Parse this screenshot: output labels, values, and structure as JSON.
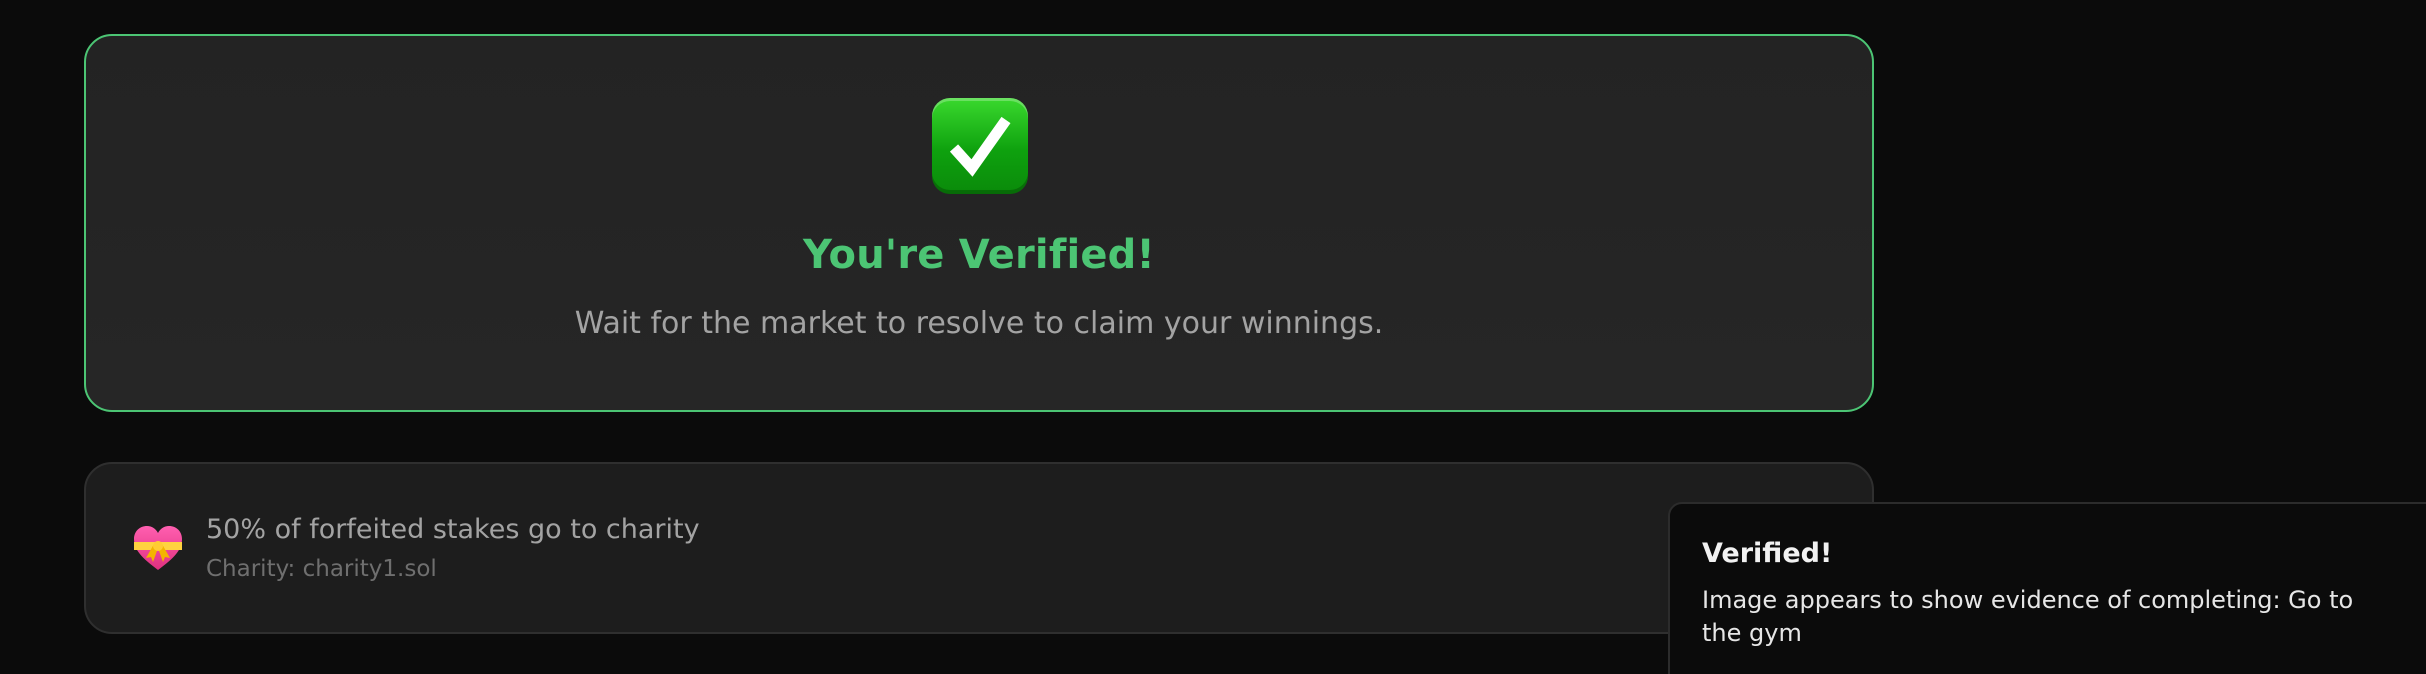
{
  "verified_card": {
    "icon": "check-mark-button-icon",
    "title": "You're Verified!",
    "subtitle": "Wait for the market to resolve to claim your winnings.",
    "accent_color": "#4cc574"
  },
  "charity_card": {
    "icon": "heart-with-ribbon-icon",
    "title": "50% of forfeited stakes go to charity",
    "subtitle": "Charity: charity1.sol"
  },
  "toast": {
    "title": "Verified!",
    "message": "Image appears to show evidence of completing: Go to the gym"
  }
}
